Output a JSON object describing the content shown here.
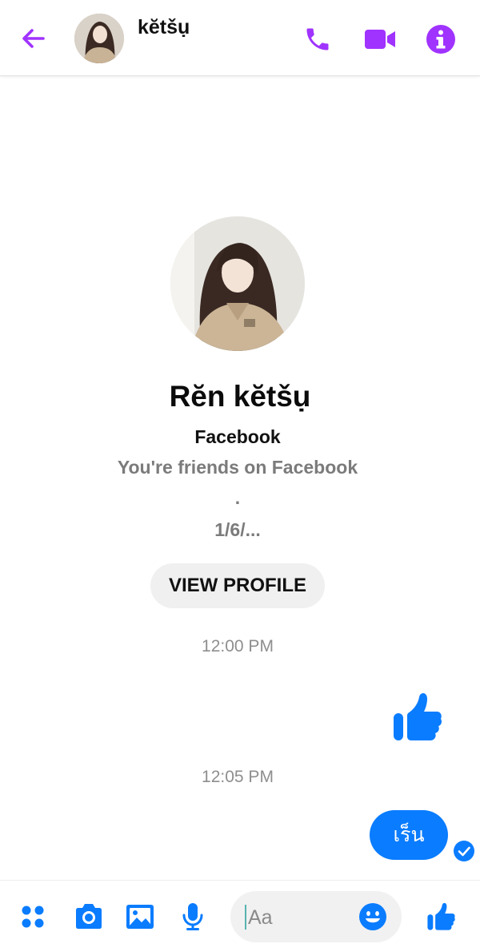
{
  "header": {
    "contact_name": "kĕtšụ",
    "back_icon": "arrow-left-icon",
    "call_icon": "phone-icon",
    "video_icon": "video-camera-icon",
    "info_icon": "info-icon",
    "accent_color": "#a033ff"
  },
  "profile": {
    "name": "Rĕn kĕtšụ",
    "source": "Facebook",
    "relationship": "You're friends on Facebook",
    "separator": ".",
    "date": "1/6/...",
    "view_profile_label": "VIEW PROFILE"
  },
  "messages": [
    {
      "timestamp": "12:00 PM",
      "type": "like",
      "icon": "thumbs-up-icon"
    },
    {
      "timestamp": "12:05 PM",
      "type": "text",
      "text": "เร็น",
      "status_icon": "seen-check-icon"
    }
  ],
  "composer": {
    "placeholder": "Aa",
    "icons": [
      "apps-icon",
      "camera-icon",
      "gallery-icon",
      "microphone-icon",
      "emoji-icon",
      "thumbs-up-icon"
    ],
    "accent_color": "#0a7cff"
  }
}
